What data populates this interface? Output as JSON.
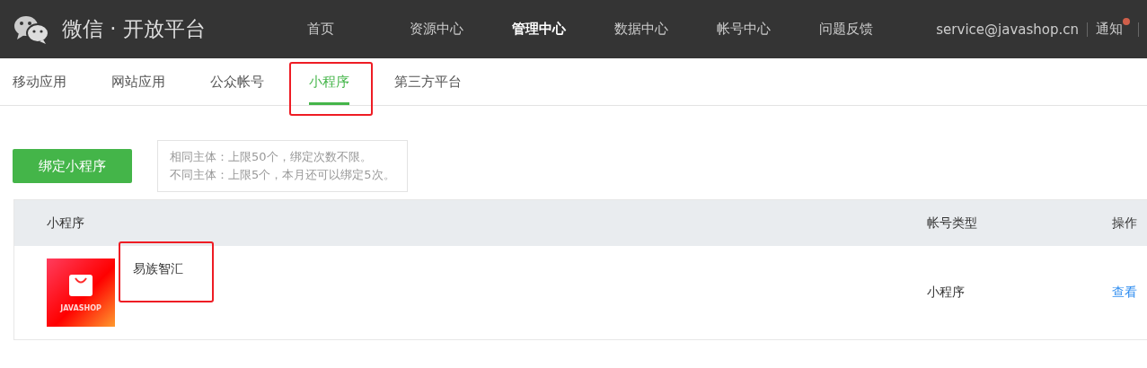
{
  "header": {
    "brand": "微信 · 开放平台",
    "nav": [
      {
        "label": "首页",
        "selected": false
      },
      {
        "label": "资源中心",
        "selected": false
      },
      {
        "label": "管理中心",
        "selected": true
      },
      {
        "label": "数据中心",
        "selected": false
      },
      {
        "label": "帐号中心",
        "selected": false
      },
      {
        "label": "问题反馈",
        "selected": false
      }
    ],
    "account": "service@javashop.cn",
    "notice": {
      "label": "通知",
      "unread": true
    }
  },
  "tabs": [
    {
      "label": "移动应用",
      "selected": false,
      "highlighted": false
    },
    {
      "label": "网站应用",
      "selected": false,
      "highlighted": false
    },
    {
      "label": "公众帐号",
      "selected": false,
      "highlighted": false
    },
    {
      "label": "小程序",
      "selected": true,
      "highlighted": true
    },
    {
      "label": "第三方平台",
      "selected": false,
      "highlighted": false
    }
  ],
  "bind_button": "绑定小程序",
  "tip": [
    "相同主体：上限50个，绑定次数不限。",
    "不同主体：上限5个，本月还可以绑定5次。"
  ],
  "table": {
    "columns": [
      "小程序",
      "帐号类型",
      "操作"
    ],
    "rows": [
      {
        "icon_label": "JAVASHOP",
        "name": "易族智汇",
        "highlighted": true,
        "type": "小程序",
        "action": "查看"
      }
    ]
  }
}
